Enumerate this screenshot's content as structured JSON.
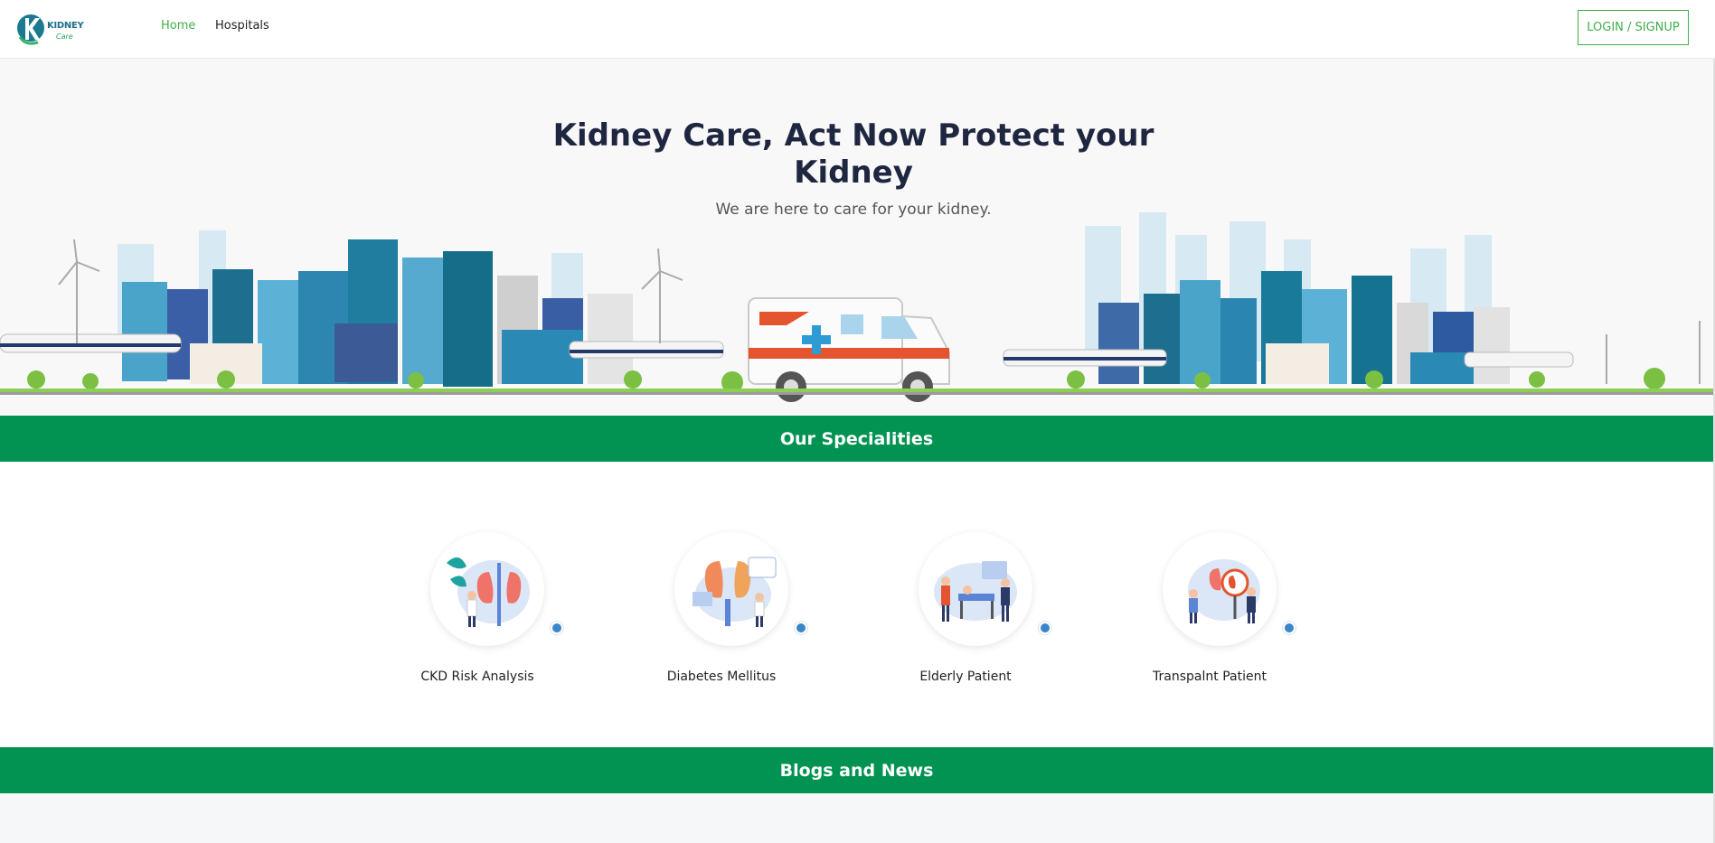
{
  "nav": {
    "logo_text_1": "KIDNEY",
    "logo_text_2": "Care",
    "links": [
      {
        "label": "Home",
        "active": true
      },
      {
        "label": "Hospitals",
        "active": false
      }
    ],
    "login_label": "LOGIN / SIGNUP"
  },
  "hero": {
    "title": "Kidney Care, Act Now Protect your Kidney",
    "subtitle": "We are here to care for your kidney."
  },
  "specialities": {
    "heading": "Our Specialities",
    "items": [
      {
        "label": "CKD Risk Analysis",
        "icon": "kidney-doctor-icon"
      },
      {
        "label": "Diabetes Mellitus",
        "icon": "kidney-monitor-icon"
      },
      {
        "label": "Elderly Patient",
        "icon": "hospital-bed-icon"
      },
      {
        "label": "Transpalnt Patient",
        "icon": "kidney-magnifier-icon"
      }
    ]
  },
  "blogs": {
    "heading": "Blogs and News"
  },
  "colors": {
    "brand_green": "#029352",
    "accent_green": "#3fae49",
    "title_navy": "#1f2640",
    "dot_blue": "#3a86c8"
  }
}
